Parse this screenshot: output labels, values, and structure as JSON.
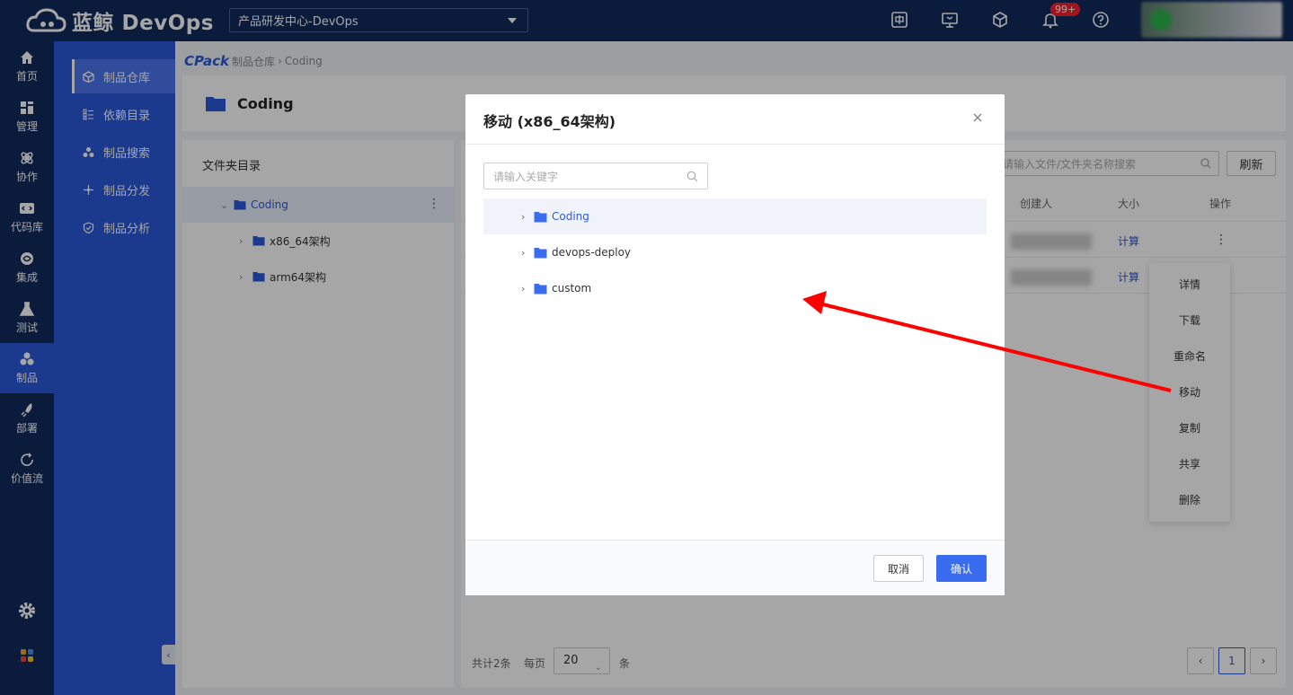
{
  "brand": {
    "name": "蓝鲸 DevOps"
  },
  "topbar": {
    "project_select": "产品研发中心-DevOps",
    "notification_badge": "99+"
  },
  "leftnav": {
    "items": [
      {
        "label": "首页",
        "icon": "home-icon"
      },
      {
        "label": "管理",
        "icon": "manage-icon"
      },
      {
        "label": "协作",
        "icon": "collab-icon"
      },
      {
        "label": "代码库",
        "icon": "code-icon"
      },
      {
        "label": "集成",
        "icon": "integrate-icon"
      },
      {
        "label": "测试",
        "icon": "test-icon"
      },
      {
        "label": "制品",
        "icon": "artifact-icon",
        "active": true
      },
      {
        "label": "部署",
        "icon": "deploy-icon"
      },
      {
        "label": "价值流",
        "icon": "valuestream-icon"
      }
    ]
  },
  "subnav": {
    "items": [
      {
        "label": "制品仓库",
        "active": true
      },
      {
        "label": "依赖目录"
      },
      {
        "label": "制品搜索"
      },
      {
        "label": "制品分发"
      },
      {
        "label": "制品分析"
      }
    ]
  },
  "breadcrumb": {
    "root": "CPack",
    "level1": "制品仓库",
    "level2": "Coding"
  },
  "repo": {
    "title": "Coding"
  },
  "tree": {
    "title": "文件夹目录",
    "root": "Coding",
    "children": [
      "x86_64架构",
      "arm64架构"
    ]
  },
  "list": {
    "search_placeholder": "请输入文件/文件夹名称搜索",
    "refresh": "刷新",
    "columns": {
      "creator": "创建人",
      "size": "大小",
      "action": "操作"
    },
    "rows": [
      {
        "size": "计算"
      },
      {
        "size": "计算"
      }
    ],
    "pager": {
      "total": "共计2条",
      "per_page": "每页",
      "size": "20",
      "unit": "条",
      "current": "1"
    }
  },
  "context_menu": {
    "items": [
      "详情",
      "下载",
      "重命名",
      "移动",
      "复制",
      "共享",
      "删除"
    ]
  },
  "modal": {
    "title": "移动 (x86_64架构)",
    "search_placeholder": "请输入关键字",
    "folders": [
      "Coding",
      "devops-deploy",
      "custom"
    ],
    "cancel": "取消",
    "confirm": "确认"
  },
  "colors": {
    "accent": "#2c5ad9",
    "topbar": "#102a5c",
    "danger": "#f5222d",
    "annotation": "#ff0000"
  }
}
